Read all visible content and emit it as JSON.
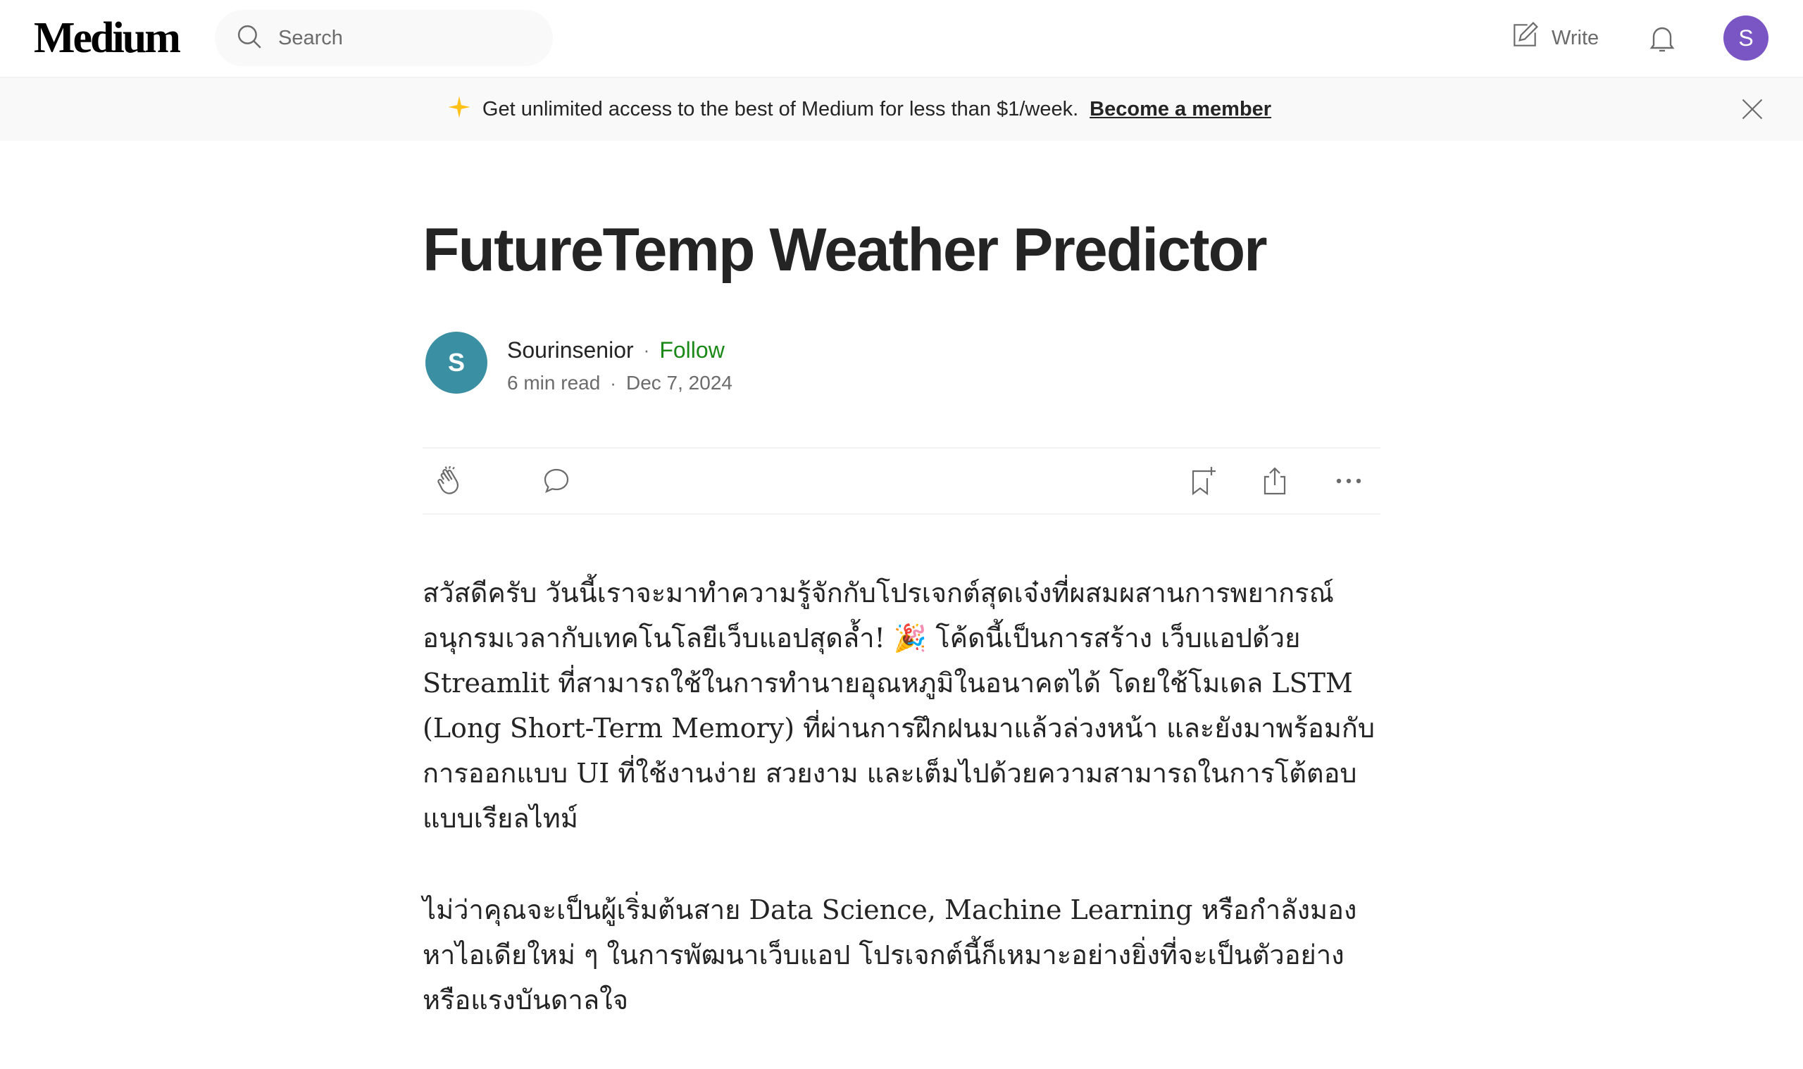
{
  "header": {
    "logo": "Medium",
    "search_placeholder": "Search",
    "write_label": "Write",
    "avatar_initial": "S"
  },
  "banner": {
    "text": "Get unlimited access to the best of Medium for less than $1/week.",
    "link": "Become a member"
  },
  "article": {
    "title": "FutureTemp Weather Predictor",
    "author": {
      "initial": "S",
      "name": "Sourinsenior",
      "follow_label": "Follow"
    },
    "read_time": "6 min read",
    "date": "Dec 7, 2024",
    "paragraphs": [
      "สวัสดีครับ วันนี้เราจะมาทำความรู้จักกับโปรเจกต์สุดเจ๋งที่ผสมผสานการพยากรณ์อนุกรมเวลากับเทคโนโลยีเว็บแอปสุดล้ำ! 🎉 โค้ดนี้เป็นการสร้าง เว็บแอปด้วย Streamlit ที่สามารถใช้ในการทำนายอุณหภูมิในอนาคตได้ โดยใช้โมเดล LSTM (Long Short-Term Memory) ที่ผ่านการฝึกฝนมาแล้วล่วงหน้า และยังมาพร้อมกับการออกแบบ UI ที่ใช้งานง่าย สวยงาม และเต็มไปด้วยความสามารถในการโต้ตอบแบบเรียลไทม์",
      "ไม่ว่าคุณจะเป็นผู้เริ่มต้นสาย Data Science, Machine Learning หรือกำลังมองหาไอเดียใหม่ ๆ ในการพัฒนาเว็บแอป โปรเจกต์นี้ก็เหมาะอย่างยิ่งที่จะเป็นตัวอย่างหรือแรงบันดาลใจ"
    ]
  },
  "colors": {
    "follow_green": "#1a8917",
    "author_avatar": "#3b8fa3",
    "user_avatar": "#7a55c4",
    "sparkle": "#ffc017"
  }
}
